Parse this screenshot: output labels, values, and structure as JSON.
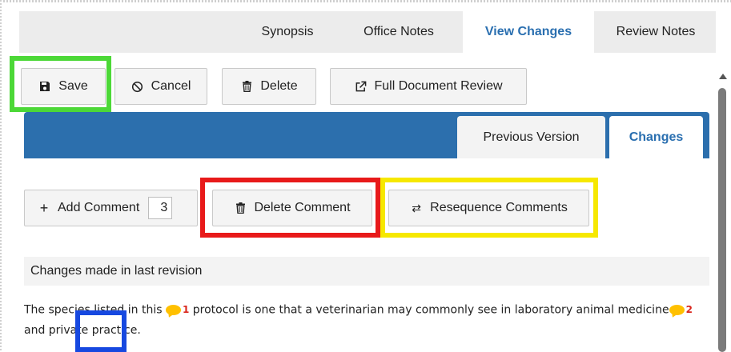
{
  "top_tabs": [
    {
      "label": "Synopsis",
      "active": false
    },
    {
      "label": "Office Notes",
      "active": false
    },
    {
      "label": "View Changes",
      "active": true
    },
    {
      "label": "Review Notes",
      "active": false
    }
  ],
  "toolbar": {
    "save_label": "Save",
    "cancel_label": "Cancel",
    "delete_label": "Delete",
    "full_review_label": "Full Document Review"
  },
  "sub_tabs": [
    {
      "label": "Previous Version",
      "active": false
    },
    {
      "label": "Changes",
      "active": true
    }
  ],
  "comment_toolbar": {
    "add_label": "Add Comment",
    "add_count": "3",
    "delete_label": "Delete Comment",
    "resequence_label": "Resequence Comments"
  },
  "changes": {
    "header": "Changes made in last revision",
    "text_part1": "The species listed in this ",
    "comment1_num": "1",
    "text_part2": " protocol is one that a veterinarian may commonly see in laboratory animal medicine",
    "comment2_num": "2",
    "text_part3": " and private practice."
  },
  "colors": {
    "accent_blue": "#2c6fad",
    "active_tab_text": "#2a6fb0",
    "comment_bubble": "#ffc000",
    "comment_number": "#d9261c",
    "highlight_green": "#4cd837",
    "highlight_red": "#e81a1a",
    "highlight_yellow": "#f6e800",
    "highlight_blue": "#1648e0"
  },
  "icons": {
    "save": "floppy-disk-icon",
    "cancel": "ban-icon",
    "delete": "trash-icon",
    "full_review": "external-link-icon",
    "add_comment": "plus-icon",
    "delete_comment": "trash-icon",
    "resequence": "swap-arrows-icon",
    "comment": "speech-bubble-icon"
  }
}
